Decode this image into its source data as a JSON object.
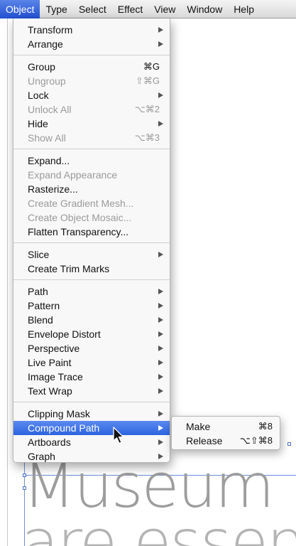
{
  "menubar": {
    "items": [
      "Object",
      "Type",
      "Select",
      "Effect",
      "View",
      "Window",
      "Help"
    ],
    "active": "Object"
  },
  "dropdown": {
    "groups": [
      [
        {
          "label": "Transform",
          "shortcut": "",
          "submenu": true,
          "enabled": true
        },
        {
          "label": "Arrange",
          "shortcut": "",
          "submenu": true,
          "enabled": true
        }
      ],
      [
        {
          "label": "Group",
          "shortcut": "⌘G",
          "submenu": false,
          "enabled": true
        },
        {
          "label": "Ungroup",
          "shortcut": "⇧⌘G",
          "submenu": false,
          "enabled": false
        },
        {
          "label": "Lock",
          "shortcut": "",
          "submenu": true,
          "enabled": true
        },
        {
          "label": "Unlock All",
          "shortcut": "⌥⌘2",
          "submenu": false,
          "enabled": false
        },
        {
          "label": "Hide",
          "shortcut": "",
          "submenu": true,
          "enabled": true
        },
        {
          "label": "Show All",
          "shortcut": "⌥⌘3",
          "submenu": false,
          "enabled": false
        }
      ],
      [
        {
          "label": "Expand...",
          "shortcut": "",
          "submenu": false,
          "enabled": true
        },
        {
          "label": "Expand Appearance",
          "shortcut": "",
          "submenu": false,
          "enabled": false
        },
        {
          "label": "Rasterize...",
          "shortcut": "",
          "submenu": false,
          "enabled": true
        },
        {
          "label": "Create Gradient Mesh...",
          "shortcut": "",
          "submenu": false,
          "enabled": false
        },
        {
          "label": "Create Object Mosaic...",
          "shortcut": "",
          "submenu": false,
          "enabled": false
        },
        {
          "label": "Flatten Transparency...",
          "shortcut": "",
          "submenu": false,
          "enabled": true
        }
      ],
      [
        {
          "label": "Slice",
          "shortcut": "",
          "submenu": true,
          "enabled": true
        },
        {
          "label": "Create Trim Marks",
          "shortcut": "",
          "submenu": false,
          "enabled": true
        }
      ],
      [
        {
          "label": "Path",
          "shortcut": "",
          "submenu": true,
          "enabled": true
        },
        {
          "label": "Pattern",
          "shortcut": "",
          "submenu": true,
          "enabled": true
        },
        {
          "label": "Blend",
          "shortcut": "",
          "submenu": true,
          "enabled": true
        },
        {
          "label": "Envelope Distort",
          "shortcut": "",
          "submenu": true,
          "enabled": true
        },
        {
          "label": "Perspective",
          "shortcut": "",
          "submenu": true,
          "enabled": true
        },
        {
          "label": "Live Paint",
          "shortcut": "",
          "submenu": true,
          "enabled": true
        },
        {
          "label": "Image Trace",
          "shortcut": "",
          "submenu": true,
          "enabled": true
        },
        {
          "label": "Text Wrap",
          "shortcut": "",
          "submenu": true,
          "enabled": true
        }
      ],
      [
        {
          "label": "Clipping Mask",
          "shortcut": "",
          "submenu": true,
          "enabled": true
        },
        {
          "label": "Compound Path",
          "shortcut": "",
          "submenu": true,
          "enabled": true,
          "highlighted": true
        },
        {
          "label": "Artboards",
          "shortcut": "",
          "submenu": true,
          "enabled": true
        },
        {
          "label": "Graph",
          "shortcut": "",
          "submenu": true,
          "enabled": true
        }
      ]
    ]
  },
  "submenu": {
    "items": [
      {
        "label": "Make",
        "shortcut": "⌘8"
      },
      {
        "label": "Release",
        "shortcut": "⌥⇧⌘8"
      }
    ]
  },
  "canvas": {
    "line1": "Museum",
    "line2": "are essen"
  },
  "colors": {
    "highlight": "#2c63e0",
    "disabled_text": "#9a9a9a",
    "guide": "#6b8fd8"
  }
}
